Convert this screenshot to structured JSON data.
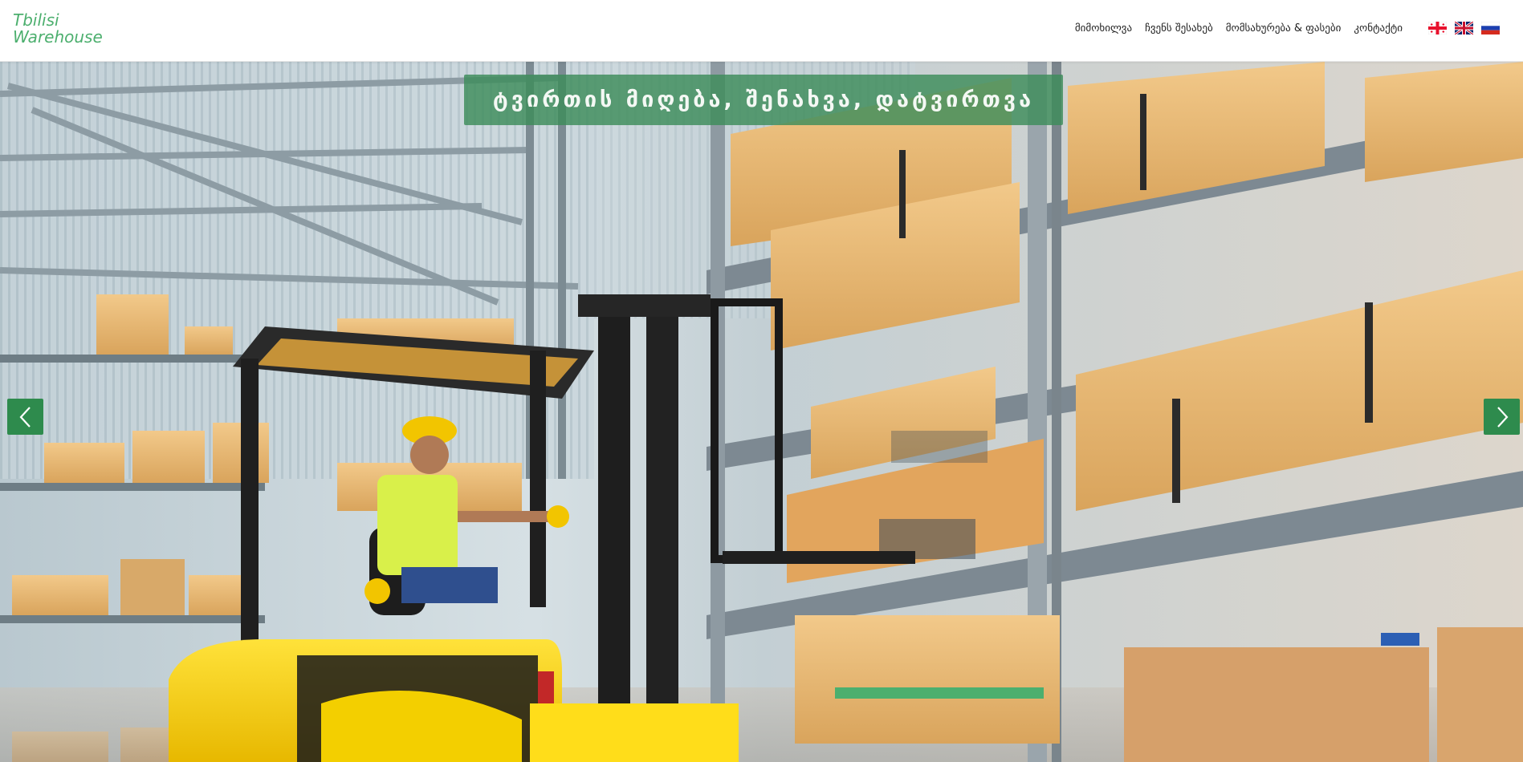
{
  "header": {
    "logo_line1": "Tbilisi",
    "logo_line2": "Warehouse",
    "nav": [
      {
        "label": "მიმოხილვა"
      },
      {
        "label": "ჩვენს შესახებ"
      },
      {
        "label": "მომსახურება & ფასები"
      },
      {
        "label": "კონტაქტი"
      }
    ],
    "languages": [
      "georgian-flag-icon",
      "uk-flag-icon",
      "russia-flag-icon"
    ]
  },
  "hero": {
    "caption": "ტვირთის მიღება, შენახვა, დატვირთვა",
    "prev_icon": "chevron-left-icon",
    "next_icon": "chevron-right-icon"
  },
  "colors": {
    "brand_green": "#4caf6e",
    "caption_bg": "#3d8c5a",
    "arrow_bg": "#2e8b4d"
  }
}
